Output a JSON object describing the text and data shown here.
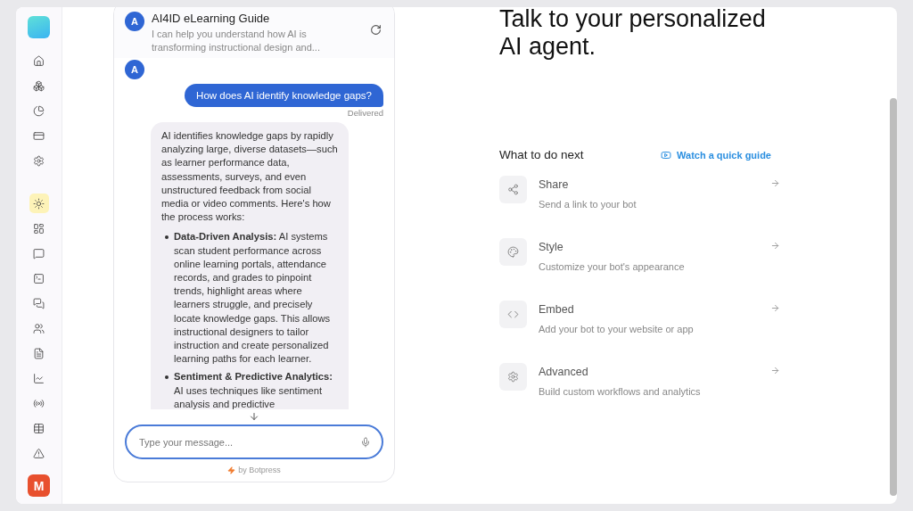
{
  "sidebar": {
    "items": [
      {
        "kind": "home",
        "selected": false
      },
      {
        "kind": "boxes",
        "selected": false
      },
      {
        "kind": "chart",
        "selected": false
      },
      {
        "kind": "card",
        "selected": false
      },
      {
        "kind": "settings",
        "selected": false
      },
      {
        "kind": "divider"
      },
      {
        "kind": "sun",
        "selected": true
      },
      {
        "kind": "layout",
        "selected": false
      },
      {
        "kind": "message",
        "selected": false
      },
      {
        "kind": "terminal",
        "selected": false
      },
      {
        "kind": "messages",
        "selected": false
      },
      {
        "kind": "users",
        "selected": false
      },
      {
        "kind": "file",
        "selected": false
      },
      {
        "kind": "line-chart",
        "selected": false
      },
      {
        "kind": "radio",
        "selected": false
      },
      {
        "kind": "table",
        "selected": false
      },
      {
        "kind": "alert",
        "selected": false
      }
    ],
    "user_avatar": "M"
  },
  "chat": {
    "header": {
      "avatar": "A",
      "title": "AI4ID eLearning Guide",
      "description": "I can help you understand how AI is transforming instructional design and..."
    },
    "messages": [
      {
        "kind": "avatar",
        "text": "A"
      },
      {
        "kind": "user",
        "text": "How does AI identify knowledge gaps?",
        "status": "Delivered"
      },
      {
        "kind": "bot",
        "intro": "AI identifies knowledge gaps by rapidly analyzing large, diverse datasets—such as learner performance data, assessments, surveys, and even unstructured feedback from social media or video comments. Here's how the process works:",
        "bullets": [
          "**Data-Driven Analysis:** AI systems scan student performance across online learning portals, attendance records, and grades to pinpoint trends, highlight areas where learners struggle, and precisely locate knowledge gaps. This allows instructional designers to tailor instruction and create personalized learning paths for each learner.",
          "**Sentiment & Predictive Analytics:** AI uses techniques like sentiment analysis and predictive"
        ]
      }
    ],
    "input": {
      "placeholder": "Type your message..."
    },
    "footer": "by Botpress"
  },
  "main": {
    "title": "Talk to your personalized AI agent.",
    "next": {
      "heading": "What to do next",
      "guide_link": "Watch a quick guide",
      "actions": [
        {
          "kind": "share",
          "title": "Share",
          "description": "Send a link to your bot"
        },
        {
          "kind": "style",
          "title": "Style",
          "description": "Customize your bot's appearance"
        },
        {
          "kind": "embed",
          "title": "Embed",
          "description": "Add your bot to your website or app"
        },
        {
          "kind": "advanced",
          "title": "Advanced",
          "description": "Build custom workflows and analytics"
        }
      ]
    }
  }
}
